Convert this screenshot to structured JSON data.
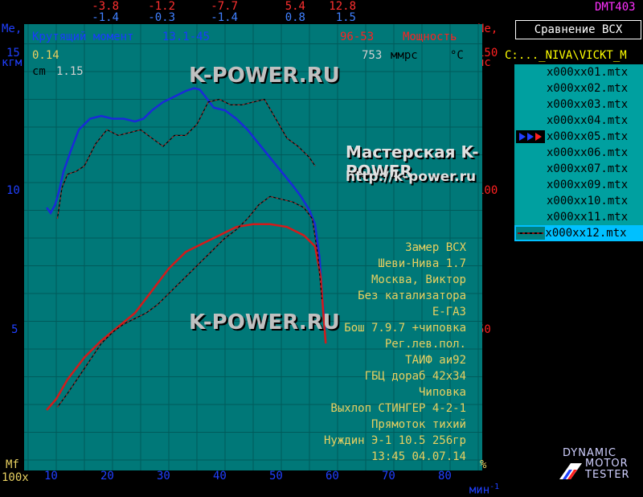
{
  "top_readouts": {
    "left_label_top": "Me,",
    "left_label_bottom": "кгм",
    "right_label_top": "Ne,",
    "right_label_bottom": "лс",
    "row1": [
      "-3.8",
      "-1.2",
      "-7.7",
      "5.4",
      "12.8"
    ],
    "row2": [
      "-1.4",
      "-0.3",
      "-1.4",
      "0.8",
      "1.5"
    ],
    "row1_colors": [
      "#ff3030",
      "#ff3030",
      "#ff3030",
      "#ff3030",
      "#ff3030"
    ],
    "row2_colors": [
      "#4080ff",
      "#4080ff",
      "#4080ff",
      "#4080ff",
      "#4080ff"
    ]
  },
  "app_title": "DMT403",
  "compare_button": "Сравнение  ВСХ",
  "current_path": "C:..._NIVA\\VICKT_M",
  "files": [
    {
      "name": "x000xx01.mtx",
      "marker": ""
    },
    {
      "name": "x000xx02.mtx",
      "marker": ""
    },
    {
      "name": "x000xx03.mtx",
      "marker": ""
    },
    {
      "name": "x000xx04.mtx",
      "marker": ""
    },
    {
      "name": "x000xx05.mtx",
      "marker": "arrows"
    },
    {
      "name": "x000xx06.mtx",
      "marker": ""
    },
    {
      "name": "x000xx07.mtx",
      "marker": ""
    },
    {
      "name": "x000xx09.mtx",
      "marker": ""
    },
    {
      "name": "x000xx10.mtx",
      "marker": ""
    },
    {
      "name": "x000xx11.mtx",
      "marker": ""
    },
    {
      "name": "x000xx12.mtx",
      "marker": "line"
    }
  ],
  "selected_file_index": 10,
  "legend": {
    "torque_label": "Крутящий момент",
    "torque_range": "13.1-45",
    "power_range": "96-53",
    "power_label": "Мощность",
    "value_1": "0.14",
    "pressure_value": "753",
    "pressure_unit": "ммрс",
    "temp_unit": "°C",
    "cm_label": "cm",
    "cm_value": "1.15"
  },
  "notes": [
    "Замер ВСХ",
    "Шеви-Нива 1.7",
    "Москва, Виктор",
    "Без катализатора",
    "E-ГАЗ",
    "Бош 7.9.7 +чиповка",
    "Рег.лев.пол.",
    "ТАИФ аи92",
    "ГБЦ дораб 42х34",
    "Чиповка",
    "Выхлоп СТИНГЕР 4-2-1",
    "Прямоток тихий",
    "Нуждин Э-1 10.5 256гр",
    "13:45 04.07.14"
  ],
  "watermarks": {
    "top": "K-POWER.RU",
    "middle": "K-POWER.RU",
    "shop": "Мастерская K-POWER",
    "url": "http://k-power.ru"
  },
  "bottom_labels": {
    "mf": "Mf",
    "x100": "100x",
    "percent": "%",
    "rpm_unit": "мин",
    "rpm_exp": "-1"
  },
  "logo": [
    "DYNAMIC",
    "MOTOR",
    "TESTER"
  ],
  "colors": {
    "plot_bg": "#007878",
    "grid": "#005a5a",
    "torque_current": "#1a2ad8",
    "power_current": "#d41a1a",
    "compare_curves": "#000000",
    "notes_text": "#e8d060",
    "left_axis": "#2040ff",
    "right_axis": "#ff2020"
  },
  "chart_data": {
    "type": "line",
    "x_ticks": [
      10,
      20,
      30,
      40,
      50,
      60,
      70,
      80
    ],
    "xlim": [
      10,
      87
    ],
    "y_left_ticks": [
      5,
      10,
      15
    ],
    "y_left_lim": [
      0,
      15.3
    ],
    "y_right_ticks": [
      50,
      100,
      150
    ],
    "y_right_lim": [
      0,
      153
    ],
    "series": [
      {
        "name": "Крутящий момент",
        "axis": "left",
        "style": "solid",
        "x": [
          13.3,
          14.0,
          14.8,
          15.5,
          16.3,
          17.5,
          19.0,
          21.0,
          23.0,
          25.0,
          27.0,
          29.0,
          30.5,
          32.0,
          34.0,
          36.0,
          38.0,
          39.5,
          40.5,
          41.5,
          43.0,
          45.0,
          47.0,
          49.0,
          51.0,
          53.0,
          55.0,
          57.0,
          58.5,
          60.0,
          61.0,
          61.8,
          62.3,
          62.8
        ],
        "y": [
          9.1,
          8.9,
          9.2,
          9.7,
          10.4,
          11.1,
          11.9,
          12.3,
          12.4,
          12.3,
          12.3,
          12.2,
          12.3,
          12.6,
          12.9,
          13.1,
          13.3,
          13.4,
          13.35,
          13.1,
          12.7,
          12.6,
          12.3,
          11.9,
          11.4,
          10.9,
          10.4,
          9.9,
          9.5,
          9.0,
          8.5,
          7.3,
          5.8,
          4.7
        ]
      },
      {
        "name": "Мощность",
        "axis": "right",
        "style": "solid",
        "x": [
          13.3,
          15.0,
          17.0,
          20.0,
          23.0,
          26.0,
          29.0,
          32.0,
          35.0,
          38.0,
          41.0,
          44.0,
          47.0,
          50.0,
          53.0,
          56.0,
          59.0,
          61.0,
          62.0,
          62.5,
          62.9
        ],
        "y": [
          18,
          22,
          29,
          37,
          43,
          48,
          53,
          61,
          69,
          75,
          78,
          81,
          84,
          85,
          85,
          84,
          81,
          77,
          66,
          52,
          42
        ]
      },
      {
        "axis": "left",
        "style": "dashed",
        "x": [
          15.2,
          16.0,
          17.0,
          18.5,
          20.0,
          22.0,
          24.0,
          26.0,
          28.0,
          30.0,
          32.0,
          34.0,
          36.0,
          38.0,
          40.0,
          42.0,
          44.0,
          46.0,
          48.0,
          50.0,
          52.0,
          54.0,
          56.0,
          58.0,
          60.0,
          61.0
        ],
        "y": [
          8.7,
          9.8,
          10.3,
          10.4,
          10.6,
          11.4,
          11.9,
          11.7,
          11.8,
          11.9,
          11.6,
          11.3,
          11.7,
          11.7,
          12.1,
          12.9,
          13.0,
          12.8,
          12.8,
          12.9,
          13.0,
          12.3,
          11.6,
          11.3,
          10.9,
          10.6
        ]
      },
      {
        "axis": "right",
        "style": "dashed",
        "x": [
          15.2,
          17.0,
          19.0,
          21.0,
          23.0,
          25.0,
          27.0,
          29.0,
          31.0,
          33.0,
          35.0,
          37.0,
          39.0,
          41.0,
          43.0,
          45.0,
          47.0,
          49.0,
          51.0,
          53.0,
          55.0,
          57.0,
          59.0,
          60.5,
          61.5,
          62.2
        ],
        "y": [
          19,
          24,
          30,
          36,
          42,
          46,
          49,
          51,
          53,
          56,
          60,
          64,
          68,
          72,
          76,
          80,
          83,
          87,
          92,
          95,
          94,
          93,
          91,
          87,
          74,
          58
        ]
      }
    ]
  }
}
